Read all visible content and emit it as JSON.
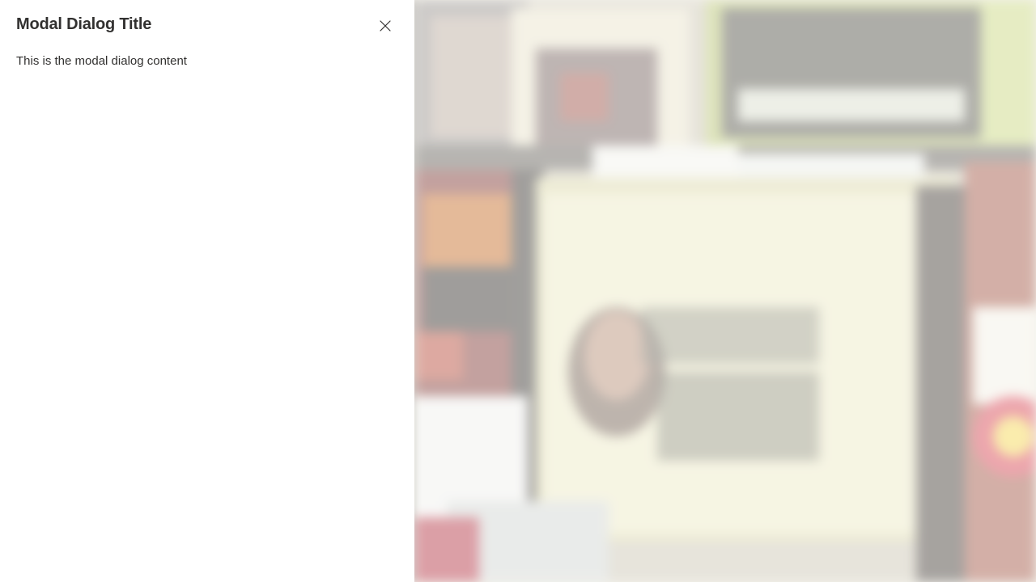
{
  "panel": {
    "title": "Modal Dialog Title",
    "content": "This is the modal dialog content",
    "close_icon": "close-icon"
  },
  "backdrop": {
    "description_icon": "blurred-photo-background"
  },
  "colors": {
    "panel_background": "#ffffff",
    "title_text": "#323130",
    "body_text": "#323130"
  }
}
